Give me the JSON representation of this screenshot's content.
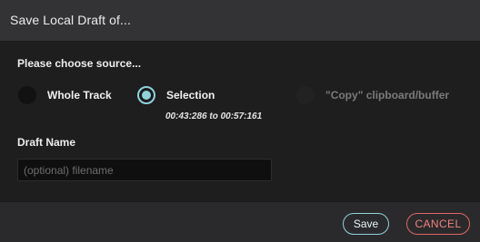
{
  "dialog": {
    "title": "Save Local Draft of..."
  },
  "source": {
    "heading": "Please choose source...",
    "options": [
      {
        "label": "Whole Track",
        "selected": false,
        "disabled": false
      },
      {
        "label": "Selection",
        "selected": true,
        "disabled": false
      },
      {
        "label": "\"Copy\" clipboard/buffer",
        "selected": false,
        "disabled": true
      }
    ],
    "selection_range": "00:43:286 to 00:57:161"
  },
  "draft": {
    "heading": "Draft Name",
    "placeholder": "(optional) filename",
    "value": ""
  },
  "footer": {
    "save_label": "Save",
    "cancel_label": "CANCEL"
  },
  "colors": {
    "accent": "#8fd2db",
    "danger": "#e06565",
    "background": "#1e1e1f"
  }
}
